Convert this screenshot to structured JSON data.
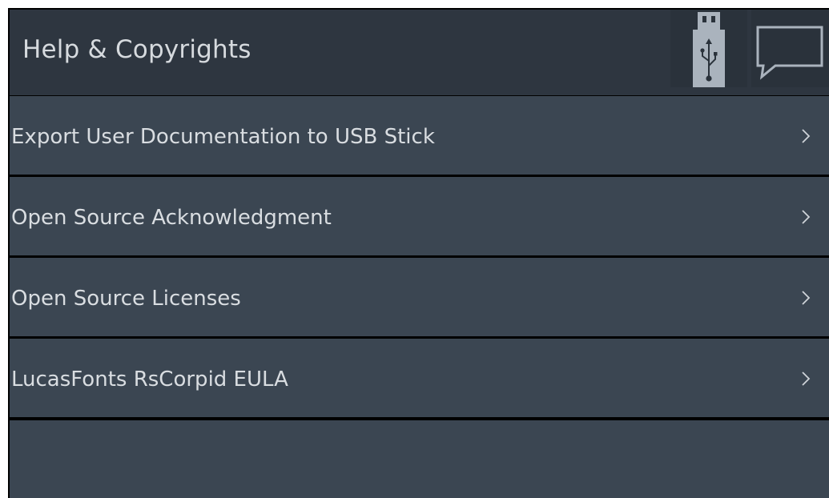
{
  "header": {
    "title": "Help & Copyrights",
    "icons": [
      "usb-icon",
      "speech-bubble-icon"
    ]
  },
  "menu": {
    "items": [
      {
        "label": "Export User Documentation to USB Stick",
        "icon": "chevron-right-icon"
      },
      {
        "label": "Open Source Acknowledgment",
        "icon": "chevron-right-icon"
      },
      {
        "label": "Open Source Licenses",
        "icon": "chevron-right-icon"
      },
      {
        "label": "LucasFonts RsCorpid EULA",
        "icon": "chevron-right-icon"
      }
    ]
  },
  "colors": {
    "header_bg": "#2e3640",
    "row_bg": "#3b4652",
    "divider": "#000000",
    "text": "#d9dde1",
    "icon": "#aab3bd"
  }
}
